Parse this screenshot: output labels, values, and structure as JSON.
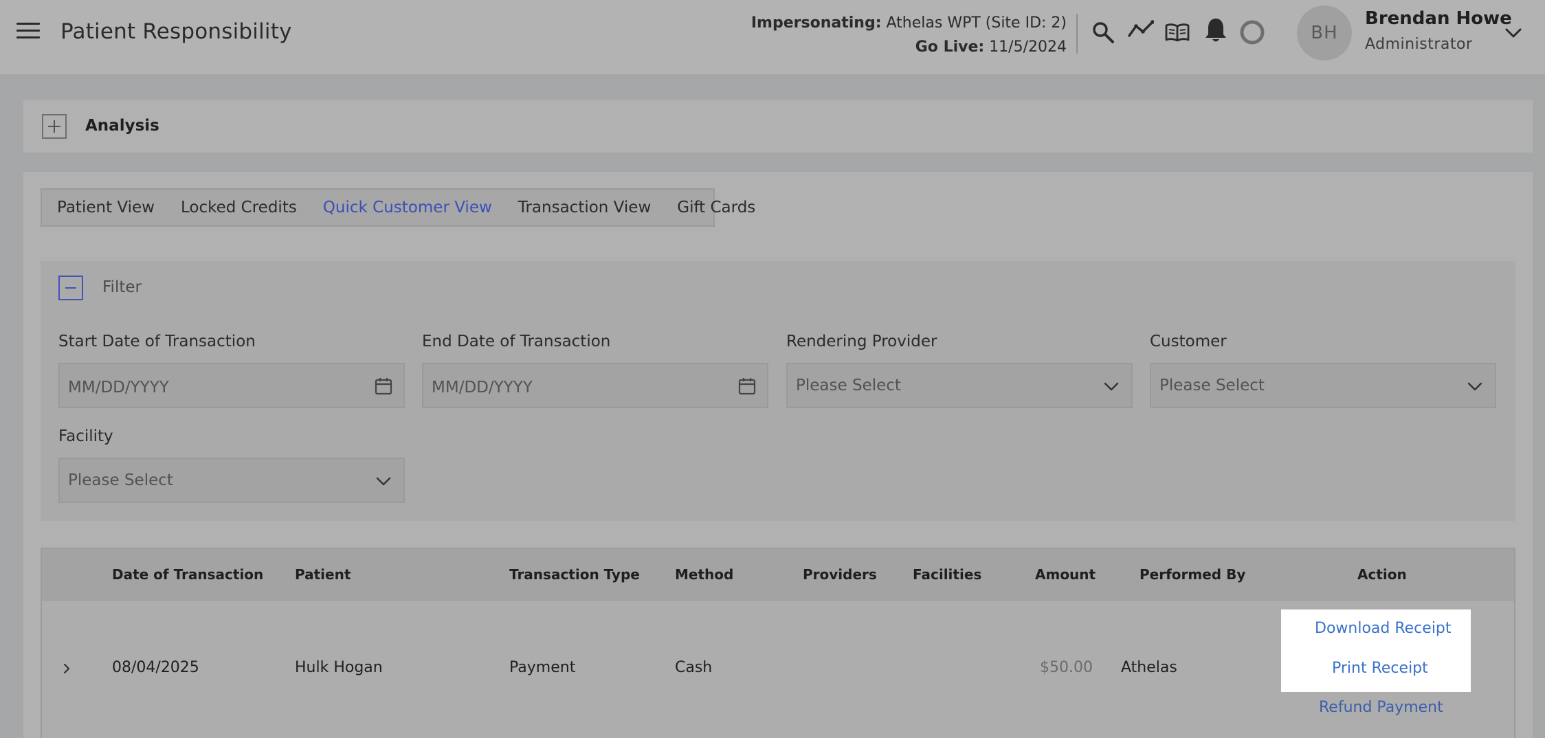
{
  "header": {
    "title": "Patient Responsibility",
    "impersonating_label": "Impersonating:",
    "impersonating_value": "Athelas WPT (Site ID: 2)",
    "go_live_label": "Go Live:",
    "go_live_value": "11/5/2024",
    "icons": [
      "menu-icon",
      "search-icon",
      "activity-icon",
      "book-icon",
      "bell-icon",
      "status-ring-icon",
      "chevron-down-icon"
    ],
    "user": {
      "initials": "BH",
      "name": "Brendan Howe",
      "role": "Administrator"
    }
  },
  "analysis": {
    "label": "Analysis"
  },
  "tabs": [
    {
      "label": "Patient View",
      "active": false
    },
    {
      "label": "Locked Credits",
      "active": false
    },
    {
      "label": "Quick Customer View",
      "active": true
    },
    {
      "label": "Transaction View",
      "active": false
    },
    {
      "label": "Gift Cards",
      "active": false
    }
  ],
  "filter": {
    "label": "Filter",
    "start_date": {
      "label": "Start Date of Transaction",
      "placeholder": "MM/DD/YYYY"
    },
    "end_date": {
      "label": "End Date of Transaction",
      "placeholder": "MM/DD/YYYY"
    },
    "rendering_provider": {
      "label": "Rendering Provider",
      "value": "Please Select"
    },
    "customer": {
      "label": "Customer",
      "value": "Please Select"
    },
    "facility": {
      "label": "Facility",
      "value": "Please Select"
    }
  },
  "table": {
    "columns": [
      "Date of Transaction",
      "Patient",
      "Transaction Type",
      "Method",
      "Providers",
      "Facilities",
      "Amount",
      "Performed By",
      "Action"
    ],
    "rows": [
      {
        "date": "08/04/2025",
        "patient": "Hulk Hogan",
        "type": "Payment",
        "method": "Cash",
        "providers": "",
        "facilities": "",
        "amount": "$50.00",
        "performed_by": "Athelas",
        "actions": [
          "Download Receipt",
          "Print Receipt",
          "Refund Payment"
        ]
      }
    ]
  },
  "colors": {
    "accent": "#3b4fb8",
    "link": "#3a72c9",
    "highlight": "#ffffff"
  }
}
